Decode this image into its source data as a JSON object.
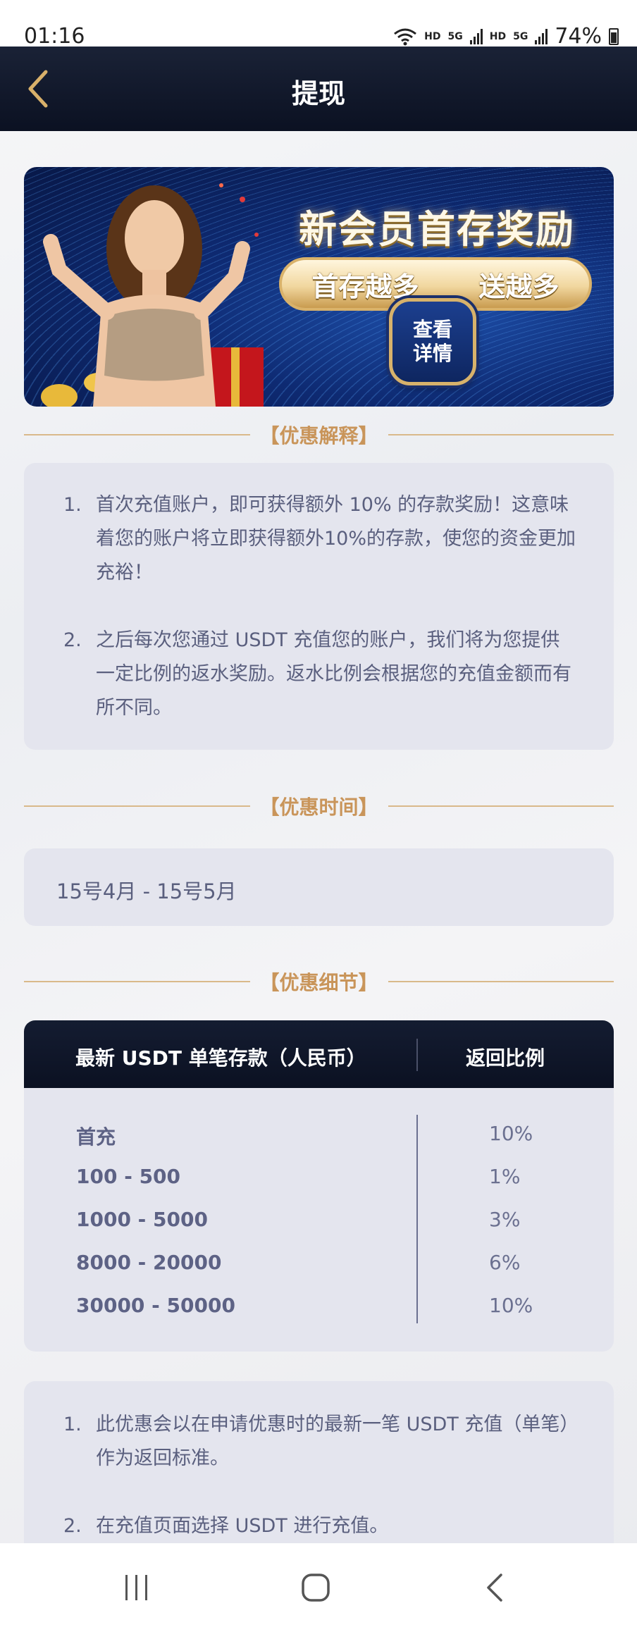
{
  "status_bar": {
    "time": "01:16",
    "hd1": "HD",
    "net1": "5G",
    "hd2": "HD",
    "net2": "5G",
    "battery": "74%"
  },
  "header": {
    "title": "提现",
    "back_icon": "chevron-left-icon",
    "accent_color": "#d8b06a"
  },
  "banner": {
    "headline": "新会员首存奖励",
    "pill_left": "首存越多",
    "pill_right": "送越多",
    "button_line1": "查看",
    "button_line2": "详情"
  },
  "sections": {
    "explanation_title": "【优惠解释】",
    "period_title": "【优惠时间】",
    "details_title": "【优惠细节】"
  },
  "explanation": {
    "items": [
      {
        "num": "1.",
        "text": "首次充值账户，即可获得额外 10% 的存款奖励！这意味着您的账户将立即获得额外10%的存款，使您的资金更加充裕！"
      },
      {
        "num": "2.",
        "text": "之后每次您通过 USDT 充值您的账户，我们将为您提供一定比例的返水奖励。返水比例会根据您的充值金额而有所不同。"
      }
    ]
  },
  "period": {
    "text": "15号4月 - 15号5月"
  },
  "table": {
    "header_left": "最新 USDT 单笔存款（人民币）",
    "header_right": "返回比例",
    "rows": [
      {
        "range": "首充",
        "rate": "10%"
      },
      {
        "range": "100 - 500",
        "rate": "1%"
      },
      {
        "range": "1000 - 5000",
        "rate": "3%"
      },
      {
        "range": "8000 - 20000",
        "rate": "6%"
      },
      {
        "range": "30000 - 50000",
        "rate": "10%"
      }
    ]
  },
  "terms": {
    "items": [
      {
        "num": "1.",
        "text": "此优惠会以在申请优惠时的最新一笔 USDT 充值（单笔）作为返回标准。"
      },
      {
        "num": "2.",
        "text": "在充值页面选择 USDT 进行充值。"
      }
    ]
  },
  "nav_bar": {
    "recents_icon": "recents-icon",
    "home_icon": "home-icon",
    "back_icon": "back-icon"
  }
}
